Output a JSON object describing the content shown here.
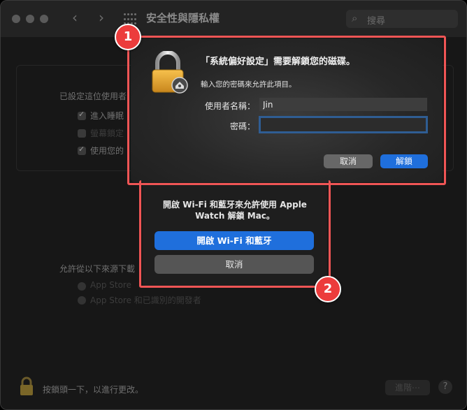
{
  "window": {
    "title": "安全性與隱私權",
    "search_placeholder": "搜尋"
  },
  "background_panel": {
    "require_password_label": "已設定這位使用者",
    "options": [
      {
        "label": "進入睡眠",
        "checked": true
      },
      {
        "label": "螢幕鎖定",
        "checked": false
      },
      {
        "label": "使用您的",
        "checked": true
      }
    ],
    "allow_apps_label": "允許從以下來源下載",
    "app_sources": [
      {
        "label": "App Store"
      },
      {
        "label": "App Store 和已識別的開發者"
      }
    ],
    "lock_hint": "按鎖頭一下，以進行更改。",
    "advanced_button": "進階⋯",
    "help_button": "?"
  },
  "wifi_dialog": {
    "message": "開啟 Wi-Fi 和藍牙來允許使用 Apple Watch 解鎖 Mac。",
    "enable_button": "開啟 Wi-Fi 和藍牙",
    "cancel_button": "取消"
  },
  "auth_dialog": {
    "title": "「系統偏好設定」需要解鎖您的磁碟。",
    "subtitle": "輸入您的密碼來允許此項目。",
    "username_label": "使用者名稱：",
    "username_value": "Jin",
    "password_label": "密碼：",
    "password_value": "",
    "cancel_button": "取消",
    "unlock_button": "解鎖"
  },
  "callouts": [
    "1",
    "2"
  ],
  "colors": {
    "accent_blue": "#1f6fdc",
    "highlight_red": "#f05555",
    "badge_red": "#ec3c3c"
  }
}
